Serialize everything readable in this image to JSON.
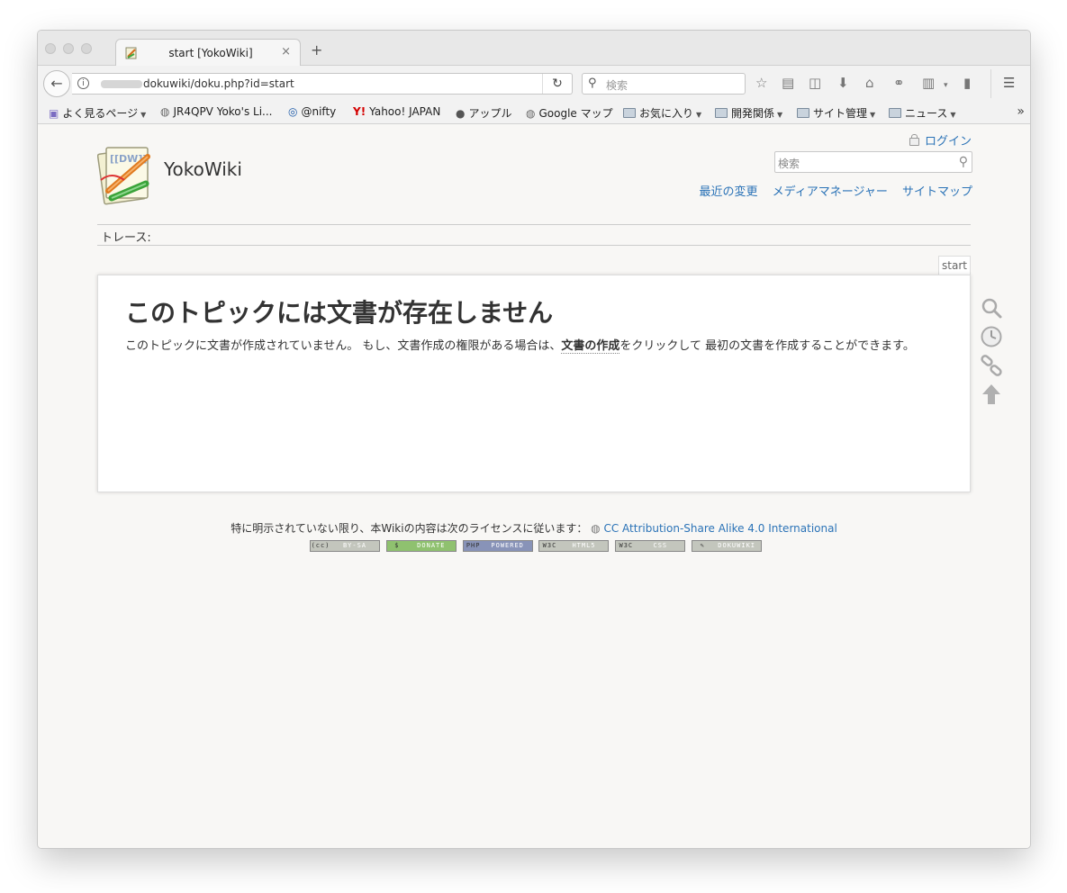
{
  "browser": {
    "tab_title": "start [YokoWiki]",
    "tab_close": "×",
    "new_tab": "+",
    "url_path": "dokuwiki/doku.php?id=start",
    "search_placeholder": "検索",
    "bookmarks": [
      {
        "label": "よく見るページ",
        "icon": "most-visited-icon",
        "dropdown": true
      },
      {
        "label": "JR4QPV Yoko's Li...",
        "icon": "globe-icon",
        "dropdown": false
      },
      {
        "label": "@nifty",
        "icon": "nifty-icon",
        "dropdown": false
      },
      {
        "label": "Yahoo! JAPAN",
        "icon": "yahoo-icon",
        "dropdown": false
      },
      {
        "label": "アップル",
        "icon": "apple-icon",
        "dropdown": false
      },
      {
        "label": "Google マップ",
        "icon": "globe-icon",
        "dropdown": false
      },
      {
        "label": "お気に入り",
        "icon": "folder-icon",
        "dropdown": true
      },
      {
        "label": "開発関係",
        "icon": "folder-icon",
        "dropdown": true
      },
      {
        "label": "サイト管理",
        "icon": "folder-icon",
        "dropdown": true
      },
      {
        "label": "ニュース",
        "icon": "folder-icon",
        "dropdown": true
      }
    ],
    "bookmarks_overflow": "»"
  },
  "wiki": {
    "site_title": "YokoWiki",
    "login": "ログイン",
    "search_placeholder": "検索",
    "toolbar": [
      "最近の変更",
      "メディアマネージャー",
      "サイトマップ"
    ],
    "trace_label": "トレース:",
    "page_id": "start",
    "heading": "このトピックには文書が存在しません",
    "body_before": "このトピックに文書が作成されていません。 もし、文書作成の権限がある場合は、",
    "body_link": "文書の作成",
    "body_after": "をクリックして 最初の文書を作成することができます。",
    "license_text": "特に明示されていない限り、本Wikiの内容は次のライセンスに従います：",
    "license_link": "CC Attribution-Share Alike 4.0 International",
    "badges": [
      {
        "lead": "(cc)",
        "label": "BY-SA",
        "color": "#c3c6bd"
      },
      {
        "lead": "$",
        "label": "DONATE",
        "color": "#8fc16f"
      },
      {
        "lead": "PHP",
        "label": "POWERED",
        "color": "#8893b8"
      },
      {
        "lead": "W3C",
        "label": "HTML5",
        "color": "#c3c6bd"
      },
      {
        "lead": "W3C",
        "label": "CSS",
        "color": "#c3c6bd"
      },
      {
        "lead": "✎",
        "label": "DOKUWIKI",
        "color": "#c3c6bd"
      }
    ]
  },
  "colors": {
    "link": "#2b73b7",
    "text": "#333333",
    "page_bg": "#f8f7f5"
  }
}
